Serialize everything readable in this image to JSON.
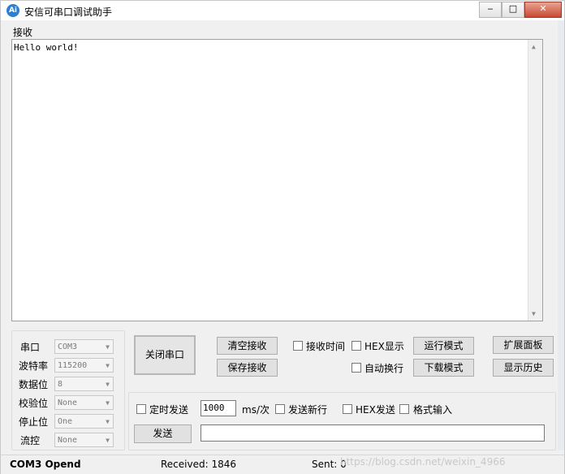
{
  "window": {
    "title": "安信可串口调试助手",
    "app_icon_text": "Ai",
    "controls": {
      "minimize": "‒",
      "maximize": "□",
      "close": "✕"
    }
  },
  "receive": {
    "label": "接收",
    "content": "Hello world!"
  },
  "serial_config": {
    "port_label": "串口",
    "port_value": "COM3",
    "baud_label": "波特率",
    "baud_value": "115200",
    "databits_label": "数据位",
    "databits_value": "8",
    "parity_label": "校验位",
    "parity_value": "None",
    "stopbits_label": "停止位",
    "stopbits_value": "One",
    "flow_label": "流控",
    "flow_value": "None"
  },
  "buttons": {
    "close_port": "关闭串口",
    "clear_receive": "清空接收",
    "save_receive": "保存接收",
    "run_mode": "运行模式",
    "download_mode": "下载模式",
    "expand_panel": "扩展面板",
    "show_history": "显示历史",
    "send": "发送"
  },
  "options": {
    "receive_time": "接收时间",
    "hex_display": "HEX显示",
    "auto_newline": "自动换行",
    "timed_send": "定时发送",
    "interval_value": "1000",
    "interval_unit": "ms/次",
    "send_newline": "发送新行",
    "hex_send": "HEX发送",
    "format_input": "格式输入"
  },
  "send_input": {
    "value": ""
  },
  "status": {
    "port_state": "COM3 Opend",
    "received": "Received: 1846",
    "sent": "Sent: 0",
    "watermark": "https://blog.csdn.net/weixin_4966"
  }
}
